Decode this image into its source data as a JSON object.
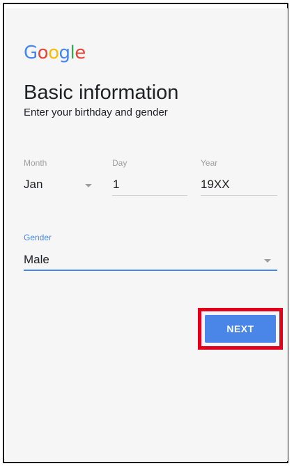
{
  "brand": {
    "logo_letters": [
      {
        "char": "G",
        "color": "#4285f4"
      },
      {
        "char": "o",
        "color": "#ea4335"
      },
      {
        "char": "o",
        "color": "#fbbc05"
      },
      {
        "char": "g",
        "color": "#4285f4"
      },
      {
        "char": "l",
        "color": "#34a853"
      },
      {
        "char": "e",
        "color": "#ea4335"
      }
    ]
  },
  "page": {
    "title": "Basic information",
    "subtitle": "Enter your birthday and gender"
  },
  "birthday": {
    "month": {
      "label": "Month",
      "value": "Jan"
    },
    "day": {
      "label": "Day",
      "value": "1"
    },
    "year": {
      "label": "Year",
      "value": "19XX"
    }
  },
  "gender": {
    "label": "Gender",
    "value": "Male"
  },
  "actions": {
    "next_label": "NEXT"
  },
  "colors": {
    "accent": "#4285f4",
    "button": "#4a86e8",
    "highlight": "#e0001b",
    "background": "#f6f6f6"
  }
}
